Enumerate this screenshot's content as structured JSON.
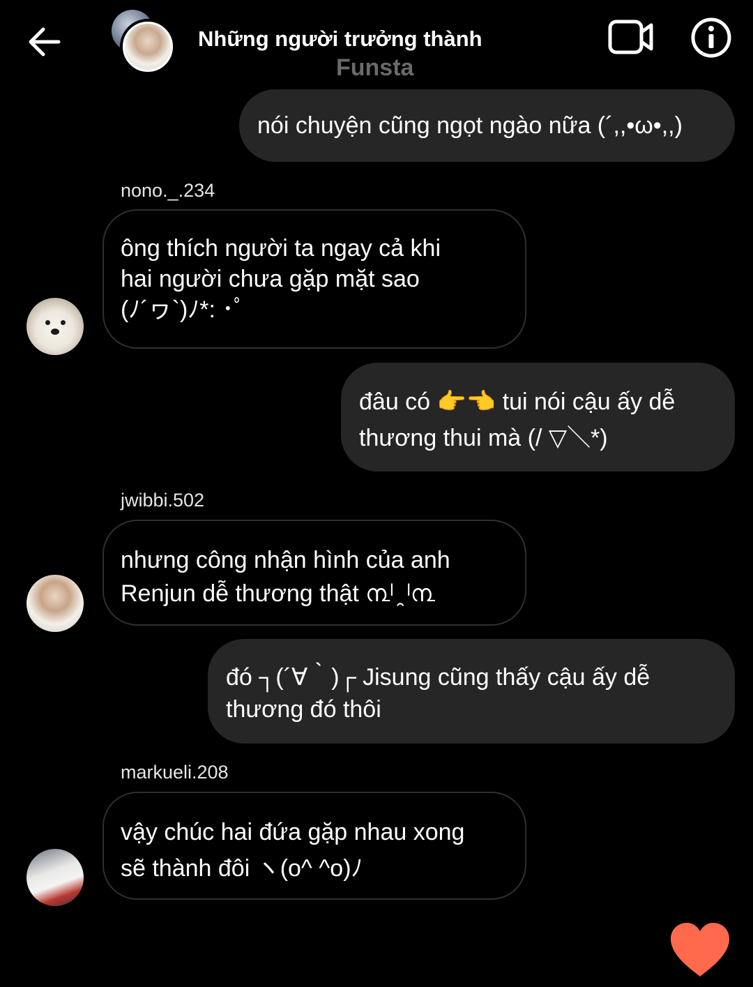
{
  "header": {
    "title": "Những người trưởng thành",
    "subtitle": "Funsta"
  },
  "colors": {
    "background": "#000000",
    "sent_bubble": "#262626",
    "received_border": "#2f2f2f",
    "subtitle": "#6a6a6a",
    "heart": "#ff6a4d"
  },
  "messages": [
    {
      "direction": "sent",
      "text": "nói chuyện cũng ngọt ngào nữa (´,,•ω•,,)"
    },
    {
      "direction": "received",
      "sender": "nono._.234",
      "text": "ông thích người ta ngay cả khi\nhai người chưa gặp mặt sao\n(ﾉ´ヮ`)ﾉ*: ･ﾟ"
    },
    {
      "direction": "sent",
      "text": "đâu có 👉👈 tui nói cậu ấy dễ\nthương thui mà (/ ▽＼*)"
    },
    {
      "direction": "received",
      "sender": "jwibbi.502",
      "text": "nhưng công nhận hình của anh\nRenjun dễ thương thật ൩ˡ ̯ ˡ൩"
    },
    {
      "direction": "sent",
      "text": "đó ┐(´∀｀)┌ Jisung cũng thấy cậu ấy dễ\nthương đó thôi"
    },
    {
      "direction": "received",
      "sender": "markueli.208",
      "text": "vậy chúc hai đứa gặp nhau xong\nsẽ thành đôi ヽ(o^ ^o)ﾉ"
    }
  ],
  "icons": {
    "back": "arrow-left-icon",
    "video": "video-camera-icon",
    "info": "info-icon",
    "like": "heart-icon"
  }
}
